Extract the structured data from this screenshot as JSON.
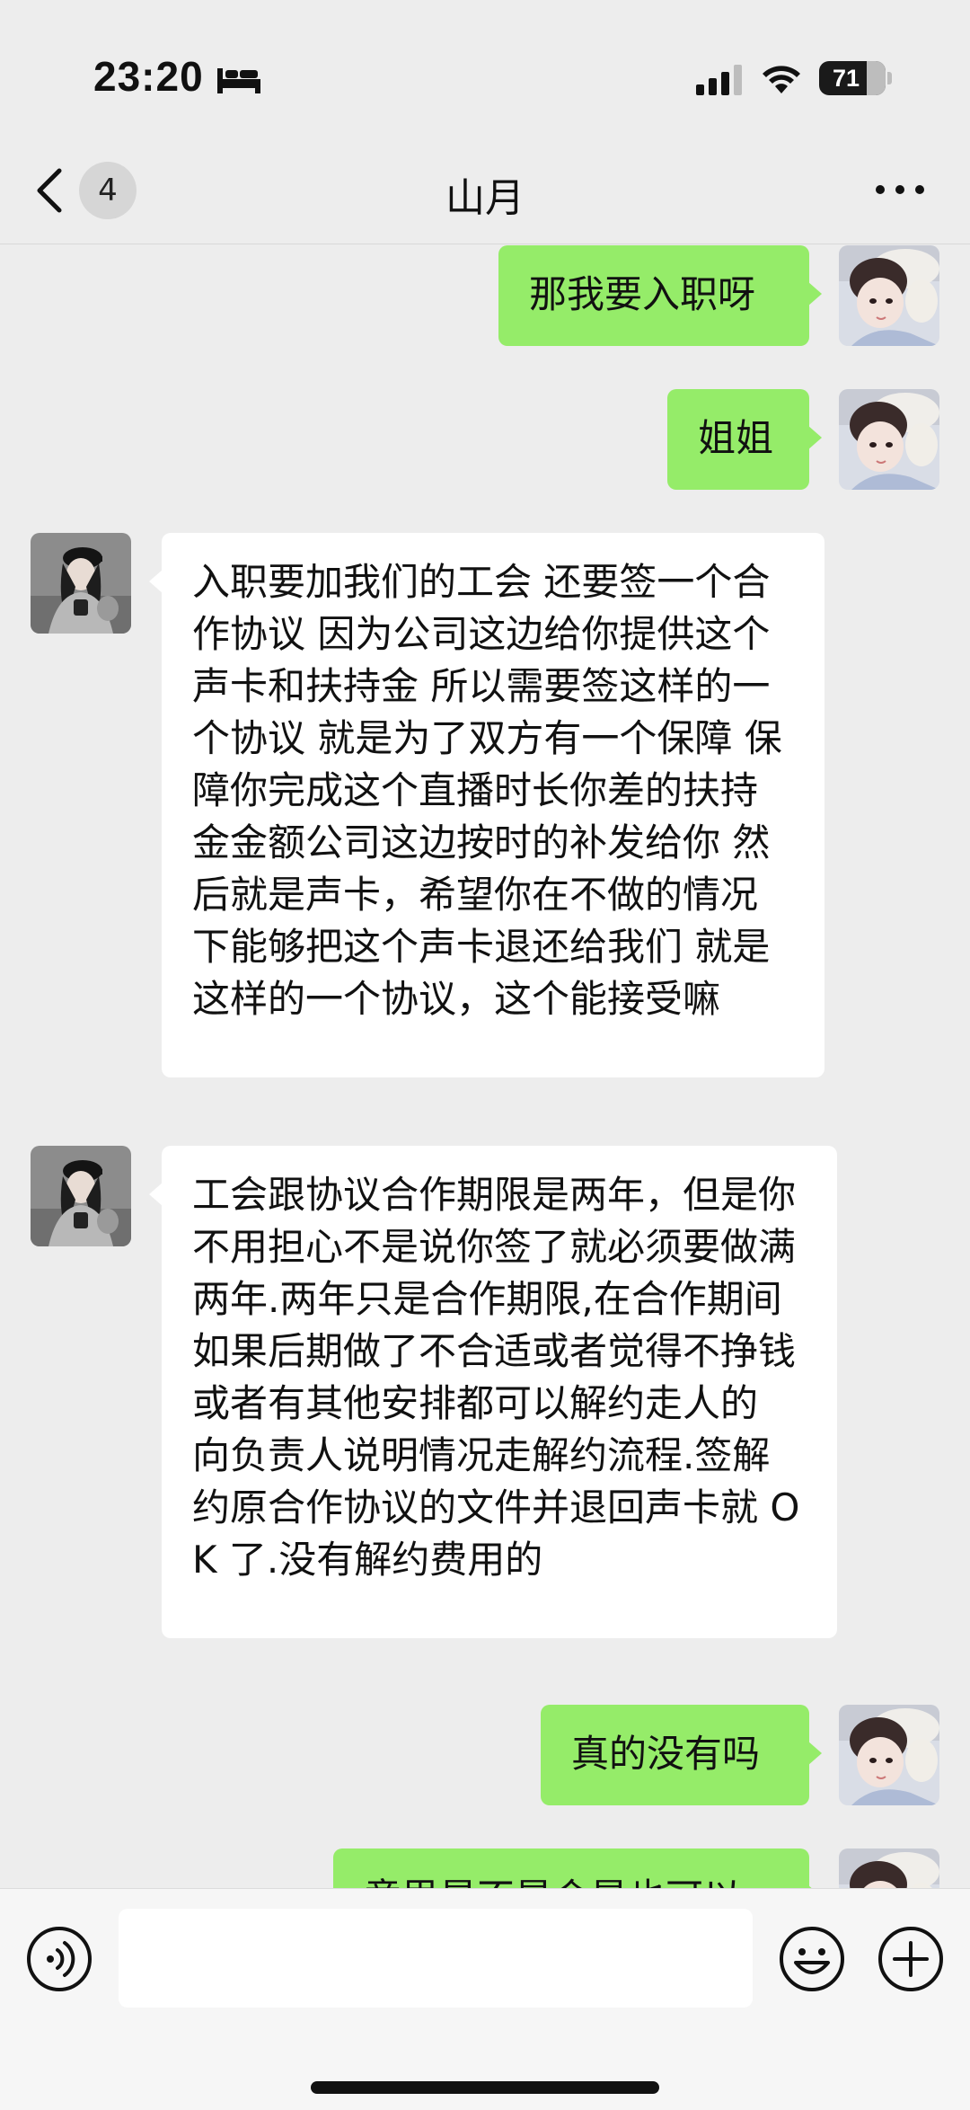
{
  "status_bar": {
    "time": "23:20",
    "battery_percent": "71",
    "battery_level": 0.71,
    "icons": [
      "bed-icon",
      "cellular-signal-icon",
      "wifi-icon",
      "battery-icon"
    ]
  },
  "nav": {
    "back_icon": "chevron-left-icon",
    "unread_count": "4",
    "title": "山月",
    "more_icon": "ellipsis-icon"
  },
  "messages": [
    {
      "side": "sent",
      "text": "那我要入职呀"
    },
    {
      "side": "sent",
      "text": "姐姐"
    },
    {
      "side": "recv",
      "text": "入职要加我们的工会 还要签一个合作协议 因为公司这边给你提供这个声卡和扶持金 所以需要签这样的一个协议 就是为了双方有一个保障 保障你完成这个直播时长你差的扶持金金额公司这边按时的补发给你 然后就是声卡，希望你在不做的情况下能够把这个声卡退还给我们 就是这样的一个协议，这个能接受嘛"
    },
    {
      "side": "recv",
      "text": "工会跟协议合作期限是两年，但是你不用担心不是说你签了就必须要做满两年.两年只是合作期限,在合作期间如果后期做了不合适或者觉得不挣钱或者有其他安排都可以解约走人的 向负责人说明情况走解约流程.签解约原合作协议的文件并退回声卡就 OK 了.没有解约费用的"
    },
    {
      "side": "sent",
      "text": "真的没有吗"
    },
    {
      "side": "sent",
      "text": "意思是不是会是也可以"
    }
  ],
  "input_bar": {
    "voice_icon": "voice-icon",
    "input_value": "",
    "emoji_icon": "smiley-icon",
    "plus_icon": "plus-icon"
  },
  "colors": {
    "background": "#ededed",
    "sent_bubble": "#95ec69",
    "received_bubble": "#ffffff"
  }
}
